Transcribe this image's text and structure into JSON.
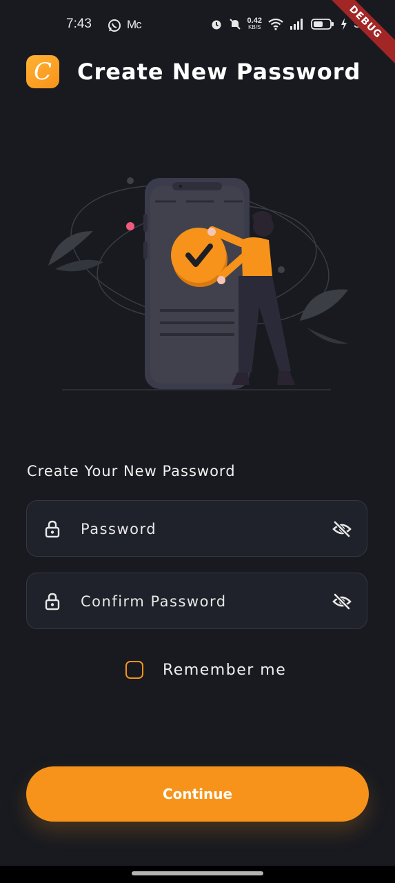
{
  "status_bar": {
    "time": "7:43",
    "notification_text": "Mc",
    "net_speed_value": "0.42",
    "net_speed_unit": "KB/S",
    "battery_percent": "57"
  },
  "debug_banner": "DEBUG",
  "header": {
    "logo_letter": "C",
    "title": "Create New Password"
  },
  "form": {
    "section_label": "Create Your New Password",
    "password_placeholder": "Password",
    "confirm_placeholder": "Confirm Password",
    "remember_label": "Remember me"
  },
  "continue_label": "Continue",
  "colors": {
    "accent": "#f7931a",
    "background": "#181a20",
    "field_bg": "#1f222a"
  }
}
